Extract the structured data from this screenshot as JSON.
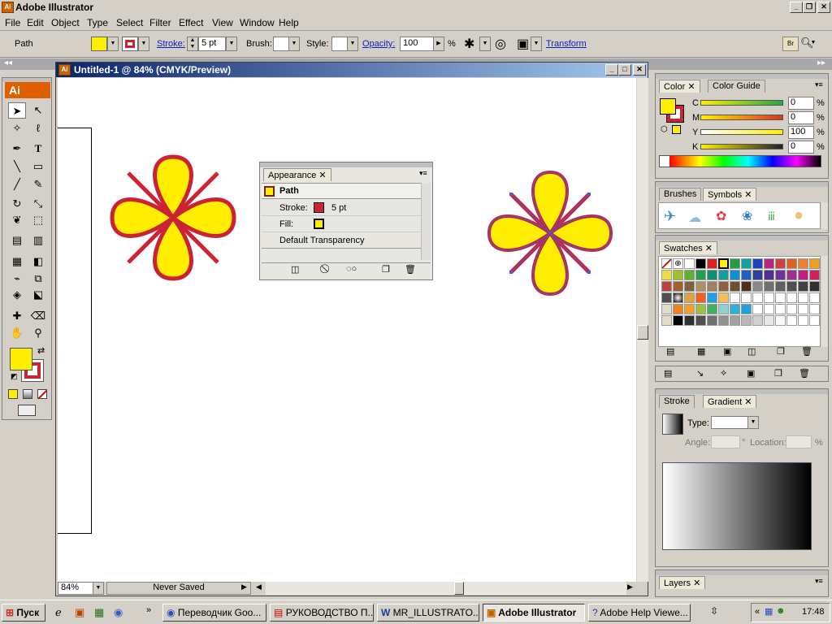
{
  "app": {
    "title": "Adobe Illustrator",
    "icon_label": "Ai"
  },
  "menu": [
    "File",
    "Edit",
    "Object",
    "Type",
    "Select",
    "Filter",
    "Effect",
    "View",
    "Window",
    "Help"
  ],
  "control": {
    "selection": "Path",
    "stroke_label": "Stroke:",
    "stroke_value": "5 pt",
    "brush_label": "Brush:",
    "style_label": "Style:",
    "opacity_label": "Opacity:",
    "opacity_value": "100",
    "percent": "%",
    "transform_label": "Transform"
  },
  "document": {
    "title": "Untitled-1 @ 84% (CMYK/Preview)",
    "zoom": "84%",
    "status": "Never Saved"
  },
  "appearance": {
    "tab": "Appearance",
    "object": "Path",
    "rows": [
      {
        "label": "Stroke:",
        "value": "5 pt"
      },
      {
        "label": "Fill:",
        "value": ""
      },
      {
        "label": "Default Transparency",
        "value": ""
      }
    ]
  },
  "color_panel": {
    "tabs": [
      "Color",
      "Color Guide"
    ],
    "channels": [
      {
        "label": "C",
        "value": "0"
      },
      {
        "label": "M",
        "value": "0"
      },
      {
        "label": "Y",
        "value": "100"
      },
      {
        "label": "K",
        "value": "0"
      }
    ],
    "percent": "%"
  },
  "brushes_panel": {
    "tabs": [
      "Brushes",
      "Symbols"
    ]
  },
  "swatches_panel": {
    "tabs": [
      "Swatches"
    ]
  },
  "gradient_panel": {
    "tabs": [
      "Stroke",
      "Gradient"
    ],
    "type_label": "Type:",
    "angle_label": "Angle:",
    "location_label": "Location:",
    "deg": "°",
    "percent": "%"
  },
  "layers_panel": {
    "tabs": [
      "Layers"
    ]
  },
  "colors": {
    "fill": "#ffee00",
    "stroke": "#cc2233",
    "accent": "#0a246a"
  },
  "taskbar": {
    "start": "Пуск",
    "tasks": [
      "Переводчик Goo...",
      "РУКОВОДСТВО П...",
      "MR_ILLUSTRATO...",
      "Adobe Illustrator",
      "Adobe Help Viewe..."
    ],
    "clock": "17:48"
  }
}
